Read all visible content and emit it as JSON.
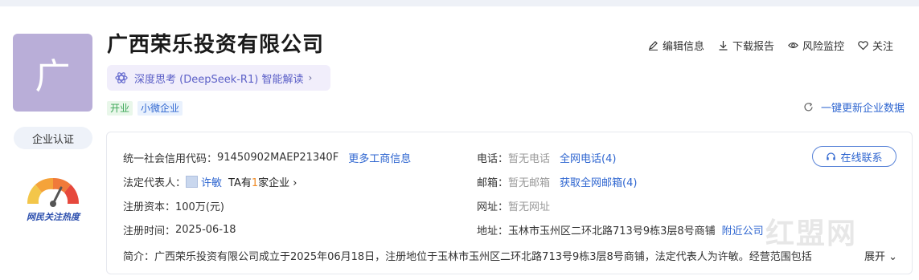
{
  "company": {
    "logo_char": "广",
    "name": "广西荣乐投资有限公司",
    "tags": [
      "开业",
      "小微企业"
    ]
  },
  "left_panel": {
    "cert_label": "企业认证",
    "heat_label": "网民关注热度"
  },
  "ai": {
    "label": "深度思考 (DeepSeek-R1) 智能解读",
    "chevron": "›"
  },
  "actions": [
    {
      "label": "编辑信息",
      "icon": "edit-icon"
    },
    {
      "label": "下载报告",
      "icon": "download-icon"
    },
    {
      "label": "风险监控",
      "icon": "eye-icon"
    },
    {
      "label": "关注",
      "icon": "heart-icon"
    }
  ],
  "refresh": {
    "label": "一键更新企业数据",
    "icon": "refresh-icon"
  },
  "info": {
    "credit_code_label": "统一社会信用代码：",
    "credit_code": "91450902MAEP21340F",
    "more_business_info": "更多工商信息",
    "legal_rep_label": "法定代表人：",
    "legal_rep": "许敏",
    "ta_has": "TA有",
    "ta_count": "1",
    "ta_suffix": "家企业",
    "ta_chevron": "›",
    "capital_label": "注册资本：",
    "capital": "100万(元)",
    "reg_time_label": "注册时间：",
    "reg_time": "2025-06-18",
    "phone_label": "电话：",
    "phone": "暂无电话",
    "all_phones": "全网电话(4)",
    "email_label": "邮箱：",
    "email": "暂无邮箱",
    "all_emails": "获取全网邮箱(4)",
    "website_label": "网址：",
    "website": "暂无网址",
    "address_label": "地址：",
    "address": "玉林市玉州区二环北路713号9栋3层8号商铺",
    "nearby": "附近公司",
    "contact_button": "在线联系",
    "summary": "简介：广西荣乐投资有限公司成立于2025年06月18日，注册地位于玉林市玉州区二环北路713号9栋3层8号商铺，法定代表人为许敏。经营范围包括",
    "expand": "展开"
  },
  "colors": {
    "brand_blue": "#2f66d0",
    "logo_bg": "#b9aed8"
  }
}
